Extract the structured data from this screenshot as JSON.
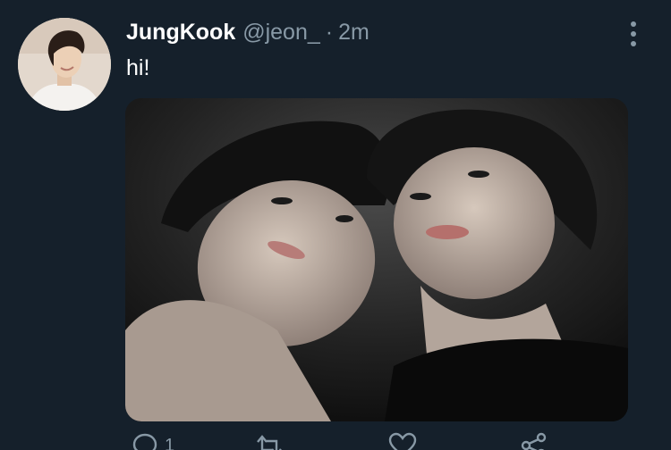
{
  "tweet": {
    "author_name": "JungKook",
    "author_handle": "@jeon_",
    "separator": "·",
    "timestamp": "2m",
    "text": "hi!"
  },
  "actions": {
    "reply_count": "1",
    "retweet_count": "",
    "like_count": "",
    "share_count": ""
  },
  "icons": {
    "more": "more-vertical-icon",
    "reply": "reply-icon",
    "retweet": "retweet-icon",
    "like": "heart-icon",
    "share": "share-icon"
  },
  "colors": {
    "background": "#15202b",
    "primary_text": "#ffffff",
    "secondary_text": "#8899a6"
  }
}
